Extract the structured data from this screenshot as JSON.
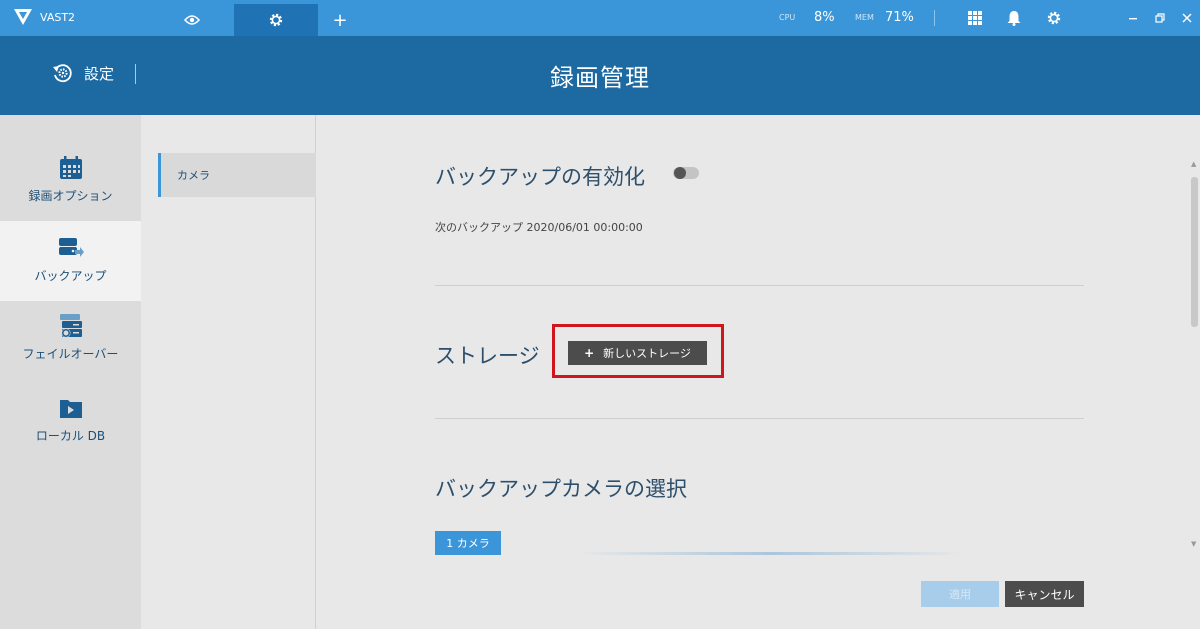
{
  "app": {
    "title": "VAST2",
    "logo": "vivotek-v-logo"
  },
  "topbar": {
    "tabs": [
      {
        "name": "live-view",
        "icon": "eye-icon"
      },
      {
        "name": "settings",
        "icon": "gear-icon",
        "active": true
      },
      {
        "name": "add",
        "icon": "plus-icon",
        "label": "+"
      }
    ],
    "cpu_label": "CPU",
    "cpu_value": "8%",
    "mem_label": "MEM",
    "mem_value": "71%",
    "icons": [
      "grid-icon",
      "bell-icon",
      "gear-icon"
    ],
    "window_controls": [
      "minimize-icon",
      "restore-icon",
      "close-icon"
    ],
    "colors": {
      "bar": "#3a96d9",
      "active_tab": "#1f72b3"
    }
  },
  "header": {
    "back_label": "設定",
    "title": "録画管理",
    "color": "#1d6aa2"
  },
  "sidebar": {
    "items": [
      {
        "label": "録画オプション",
        "icon": "calendar-icon"
      },
      {
        "label": "バックアップ",
        "icon": "backup-drive-icon",
        "active": true
      },
      {
        "label": "フェイルオーバー",
        "icon": "failover-server-icon"
      },
      {
        "label": "ローカル DB",
        "icon": "folder-icon"
      }
    ]
  },
  "subnav": {
    "items": [
      {
        "label": "カメラ",
        "active": true
      }
    ]
  },
  "main": {
    "backup_enable_title": "バックアップの有効化",
    "backup_enabled": false,
    "next_backup": "次のバックアップ 2020/06/01 00:00:00",
    "storage_title": "ストレージ",
    "new_storage_button": "新しいストレージ",
    "new_storage_plus": "+",
    "camera_select_title": "バックアップカメラの選択",
    "camera_count_label": "1 カメラ",
    "apply_button": "適用",
    "cancel_button": "キャンセル",
    "highlight_color": "#d0161c"
  },
  "scrollbar": {
    "up_arrow": "▲",
    "down_arrow": "▼"
  }
}
